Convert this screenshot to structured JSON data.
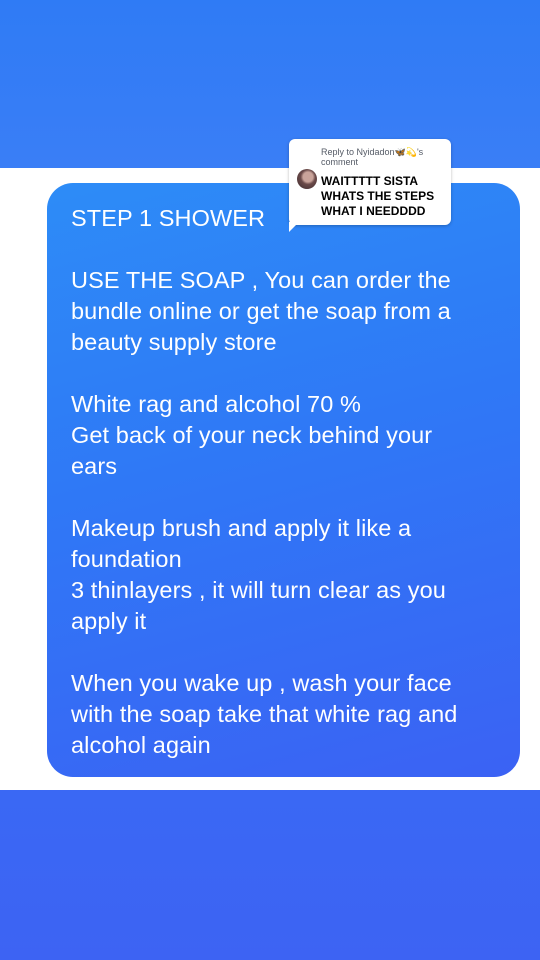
{
  "note": {
    "lines": [
      "STEP 1 SHOWER",
      "",
      "USE THE SOAP , You can order the",
      "bundle online or get the soap from a",
      "beauty supply store",
      "",
      "White rag and alcohol 70 %",
      "Get back of your neck behind your",
      "ears",
      "",
      "Makeup brush and apply it like a",
      "foundation",
      "3 thinlayers , it will turn clear as you",
      "apply it",
      "",
      "When you wake up , wash your face",
      "with the soap take that white rag and",
      "alcohol again"
    ]
  },
  "reply": {
    "header_prefix": "Reply to Nyidadon",
    "header_emoji": "🦋💫",
    "header_suffix": "'s",
    "header_line2": "comment",
    "body_lines": [
      "WAITTTTT SISTA",
      "WHATS THE STEPS",
      "WHAT I NEEDDDD"
    ]
  },
  "colors": {
    "band": "#2f7bf5",
    "card_top": "#2d8cf7",
    "card_bottom": "#3b62f4",
    "text": "#ffffff"
  }
}
